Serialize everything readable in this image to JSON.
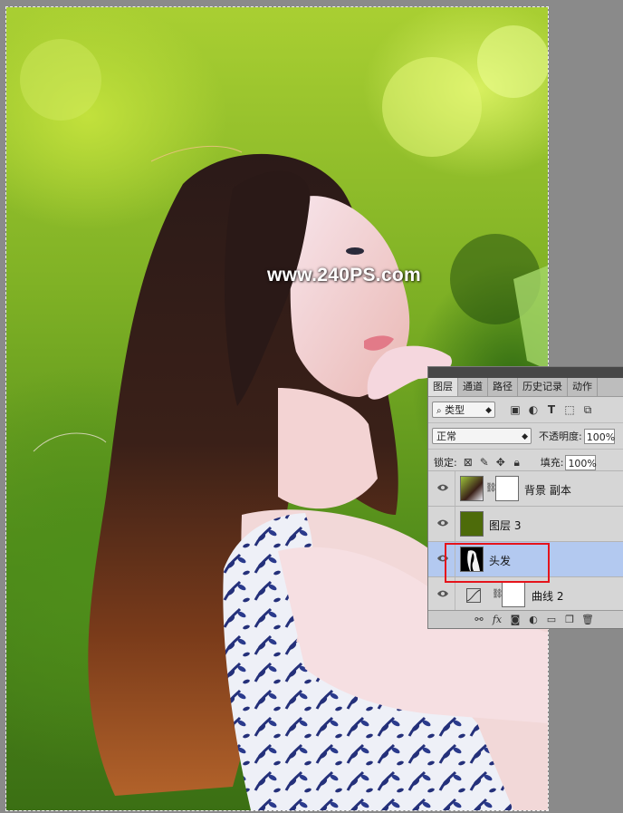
{
  "watermark": "www.240PS.com",
  "panel": {
    "tabs": [
      "图层",
      "通道",
      "路径",
      "历史记录",
      "动作"
    ],
    "active_tab": "图层",
    "filter": {
      "value": "类型",
      "search_icon": "search-icon"
    },
    "blend_mode": "正常",
    "opacity_label": "不透明度:",
    "opacity_value": "100%",
    "lock_label": "锁定:",
    "fill_label": "填充:",
    "fill_value": "100%",
    "layers": [
      {
        "name": "背景 副本",
        "visible": true,
        "has_mask": true,
        "selected": false
      },
      {
        "name": "图层 3",
        "visible": true,
        "has_mask": false,
        "selected": false,
        "fill_color": "#4d6b0a"
      },
      {
        "name": "头发",
        "visible": true,
        "has_mask": false,
        "selected": true
      },
      {
        "name": "曲线 2",
        "visible": true,
        "has_mask": true,
        "selected": false,
        "adjustment": true
      }
    ],
    "bottom_icons": [
      "link-icon",
      "fx-icon",
      "mask-icon",
      "adjustment-icon",
      "folder-icon",
      "new-layer-icon",
      "trash-icon"
    ]
  },
  "colors": {
    "selection_blue": "#b3c9f0",
    "highlight_red": "#e5141b",
    "panel_bg": "#d6d6d6"
  }
}
